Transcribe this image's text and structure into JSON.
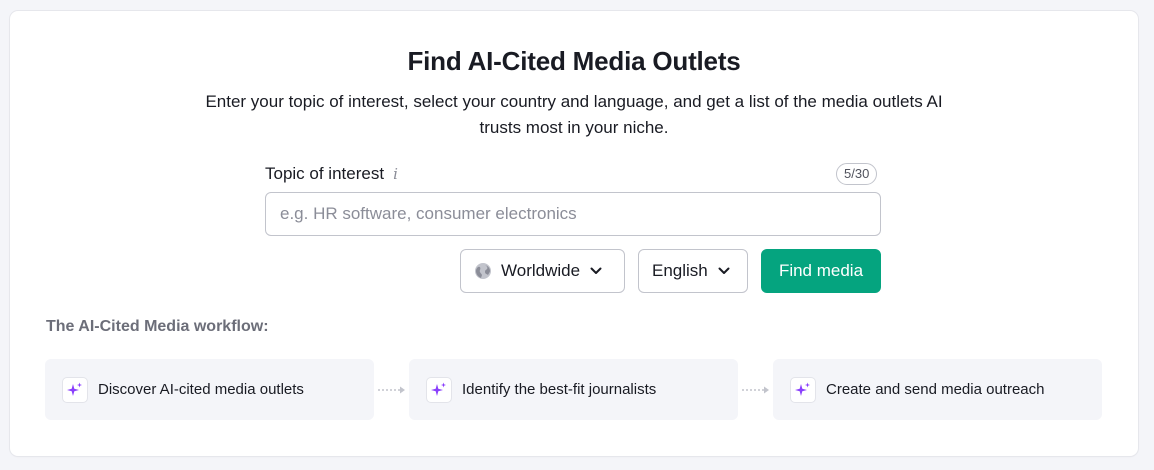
{
  "header": {
    "title": "Find AI-Cited Media Outlets",
    "subtitle": "Enter your topic of interest, select your country and language, and get a list of the media outlets AI trusts most in your niche."
  },
  "form": {
    "topic_label": "Topic of interest",
    "info_glyph": "i",
    "counter": "5/30",
    "topic_value": "",
    "topic_placeholder": "e.g. HR software, consumer electronics",
    "country": {
      "value": "Worldwide",
      "icon": "globe-icon"
    },
    "language": {
      "value": "English"
    },
    "submit_label": "Find media"
  },
  "workflow": {
    "title": "The AI-Cited Media workflow:",
    "steps": [
      {
        "label": "Discover AI-cited media outlets",
        "icon": "sparkle-icon"
      },
      {
        "label": "Identify the best-fit journalists",
        "icon": "sparkle-icon"
      },
      {
        "label": "Create and send media outreach",
        "icon": "sparkle-icon"
      }
    ]
  },
  "colors": {
    "accent": "#05a47f",
    "sparkle": "#8a3ffc",
    "background": "#f4f5f9"
  }
}
